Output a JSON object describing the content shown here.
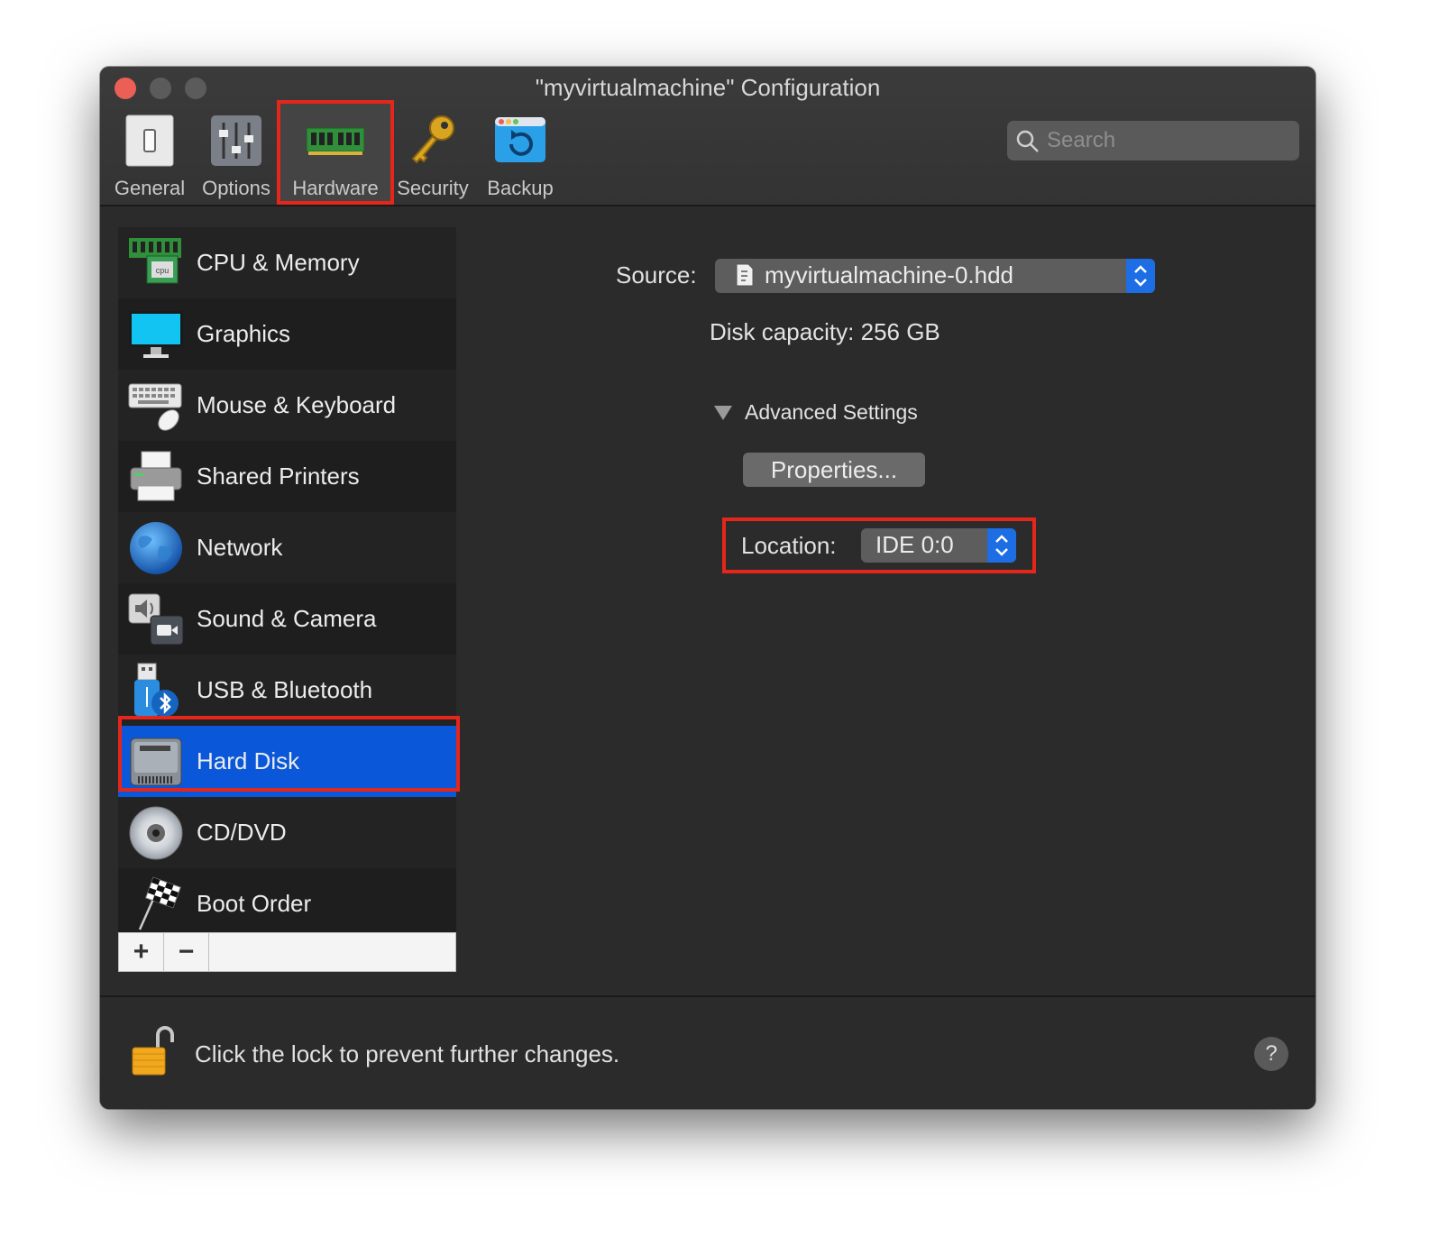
{
  "window": {
    "title": "\"myvirtualmachine\" Configuration"
  },
  "toolbar": {
    "tabs": [
      {
        "label": "General",
        "icon": "switch-icon"
      },
      {
        "label": "Options",
        "icon": "sliders-icon"
      },
      {
        "label": "Hardware",
        "icon": "ram-module-icon",
        "selected": true
      },
      {
        "label": "Security",
        "icon": "key-icon"
      },
      {
        "label": "Backup",
        "icon": "backup-icon"
      }
    ],
    "search_placeholder": "Search"
  },
  "sidebar": {
    "items": [
      {
        "label": "CPU & Memory",
        "icon": "cpu-memory-icon"
      },
      {
        "label": "Graphics",
        "icon": "monitor-icon"
      },
      {
        "label": "Mouse & Keyboard",
        "icon": "keyboard-icon"
      },
      {
        "label": "Shared Printers",
        "icon": "printer-icon"
      },
      {
        "label": "Network",
        "icon": "globe-icon"
      },
      {
        "label": "Sound & Camera",
        "icon": "sound-camera-icon"
      },
      {
        "label": "USB & Bluetooth",
        "icon": "usb-bluetooth-icon"
      },
      {
        "label": "Hard Disk",
        "icon": "hard-disk-icon",
        "selected": true
      },
      {
        "label": "CD/DVD",
        "icon": "cd-dvd-icon"
      },
      {
        "label": "Boot Order",
        "icon": "checkered-flag-icon"
      }
    ],
    "add_label": "+",
    "remove_label": "−"
  },
  "detail": {
    "source_label": "Source:",
    "source_value": "myvirtualmachine-0.hdd",
    "capacity": "Disk capacity: 256 GB",
    "advanced_label": "Advanced Settings",
    "properties_label": "Properties...",
    "location_label": "Location:",
    "location_value": "IDE 0:0"
  },
  "footer": {
    "lock_text": "Click the lock to prevent further changes.",
    "help_label": "?"
  },
  "colors": {
    "accent": "#0a58d9",
    "highlight": "#e4261b",
    "window_bg": "#2b2b2b"
  }
}
